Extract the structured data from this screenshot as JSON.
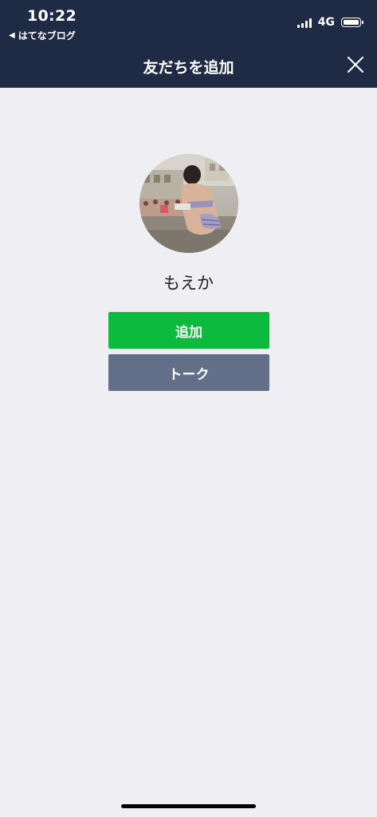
{
  "status_bar": {
    "time": "10:22",
    "back_app": "はてなブログ",
    "network": "4G",
    "signal_icon": "cellular-signal-icon",
    "battery_icon": "battery-icon"
  },
  "nav": {
    "title": "友だちを追加",
    "close_icon": "close-icon"
  },
  "profile": {
    "name": "もえか",
    "avatar": "profile-photo"
  },
  "actions": {
    "add_label": "追加",
    "talk_label": "トーク"
  },
  "colors": {
    "header_bg": "#1f2b45",
    "page_bg": "#efeef3",
    "add_button": "#0cba3e",
    "talk_button": "#636f88"
  }
}
